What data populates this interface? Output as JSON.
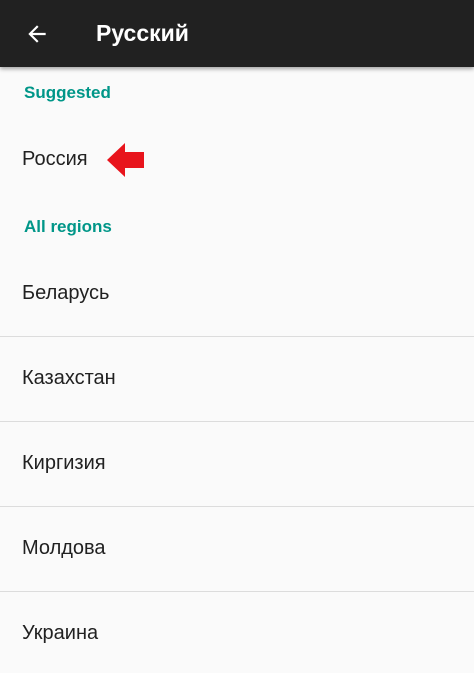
{
  "toolbar": {
    "back_icon": "arrow-back-icon",
    "title": "Русский",
    "background": "#212121"
  },
  "sections": {
    "suggested_header": "Suggested",
    "all_regions_header": "All regions",
    "header_color": "#009688"
  },
  "suggested": {
    "items": [
      {
        "label": "Россия"
      }
    ]
  },
  "annotation": {
    "icon": "red-arrow-icon",
    "color": "#e8141c"
  },
  "regions": {
    "items": [
      {
        "label": "Беларусь"
      },
      {
        "label": "Казахстан"
      },
      {
        "label": "Киргизия"
      },
      {
        "label": "Молдова"
      },
      {
        "label": "Украина"
      }
    ]
  }
}
